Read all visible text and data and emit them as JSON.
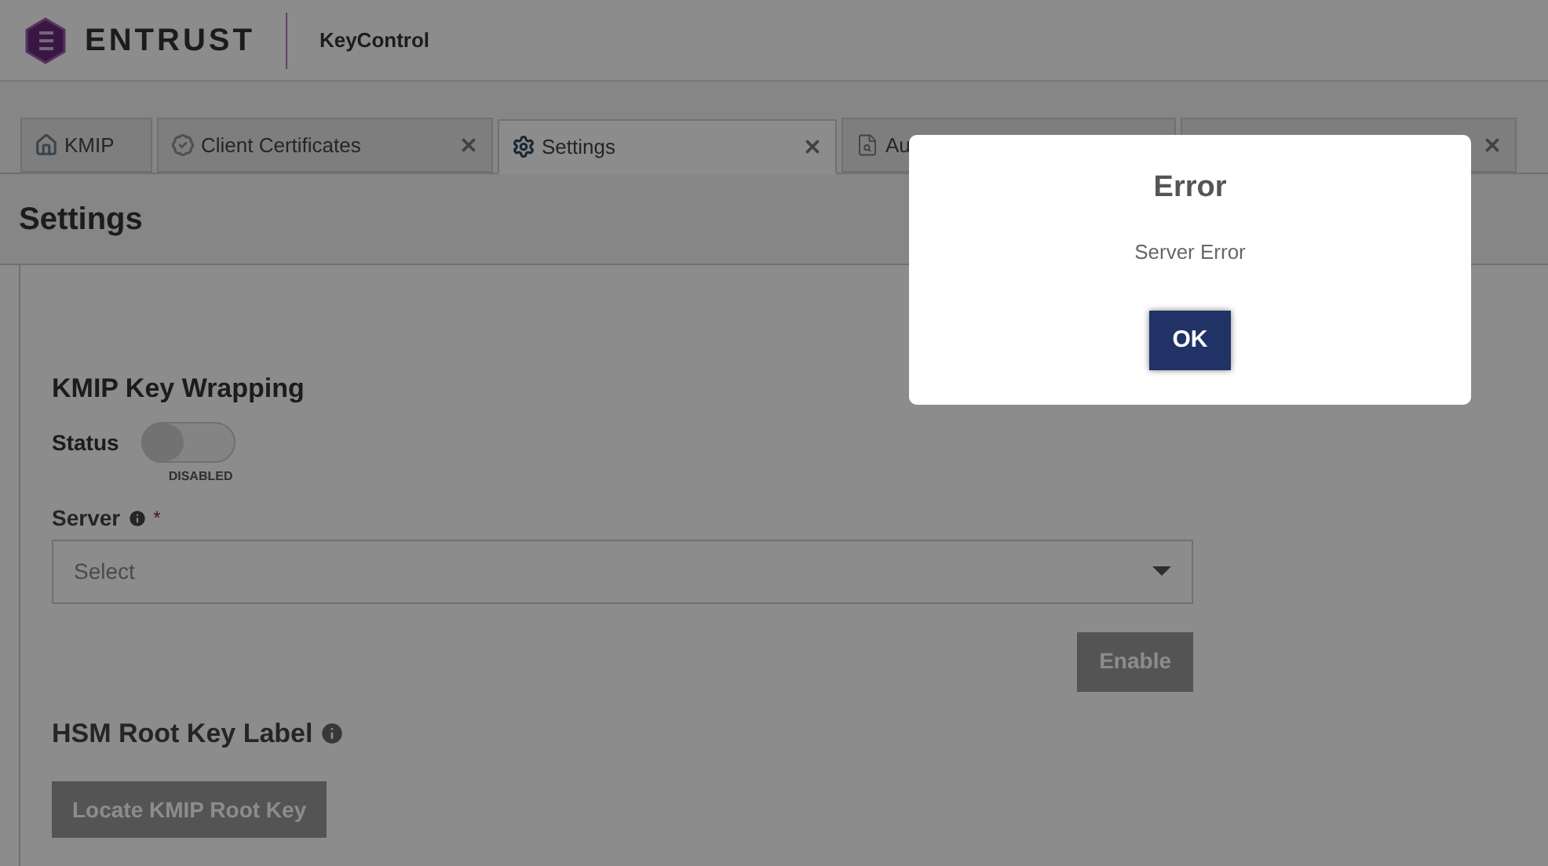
{
  "header": {
    "brand": "ENTRUST",
    "product": "KeyControl"
  },
  "tabs": [
    {
      "label": "KMIP",
      "kind": "home",
      "selected": false,
      "closable": false
    },
    {
      "label": "Client Certificates",
      "kind": "badge",
      "selected": false,
      "closable": true
    },
    {
      "label": "Settings",
      "kind": "gear",
      "selected": true,
      "closable": true
    },
    {
      "label": "Au",
      "kind": "file",
      "selected": false
    },
    {
      "selected": false,
      "closable": true
    }
  ],
  "page_title": "Settings",
  "section": {
    "title": "KMIP Key Wrapping",
    "status_label": "Status",
    "status_on": false,
    "status_text": "DISABLED",
    "server_label": "Server",
    "required_mark": "*",
    "server_placeholder": "Select",
    "enable_button": "Enable",
    "enable_disabled": true
  },
  "hsm": {
    "title": "HSM Root Key Label",
    "locate_button": "Locate KMIP Root Key",
    "locate_disabled": true
  },
  "dialog": {
    "title": "Error",
    "message": "Server Error",
    "ok": "OK"
  }
}
